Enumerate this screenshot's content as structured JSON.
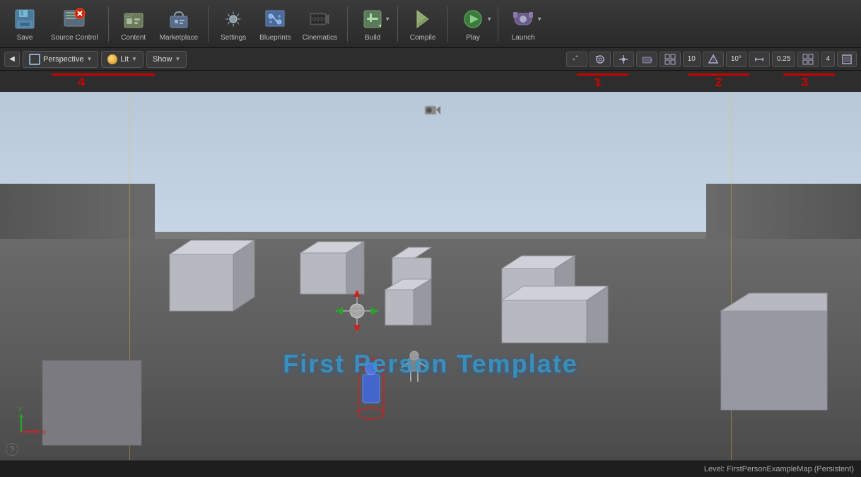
{
  "toolbar": {
    "buttons": [
      {
        "id": "save",
        "label": "Save",
        "icon": "💾"
      },
      {
        "id": "source-control",
        "label": "Source Control",
        "icon": "📁",
        "badge": "!"
      },
      {
        "id": "content",
        "label": "Content",
        "icon": "📂"
      },
      {
        "id": "marketplace",
        "label": "Marketplace",
        "icon": "🛒"
      },
      {
        "id": "settings",
        "label": "Settings",
        "icon": "⚙️"
      },
      {
        "id": "blueprints",
        "label": "Blueprints",
        "icon": "📋"
      },
      {
        "id": "cinematics",
        "label": "Cinematics",
        "icon": "🎬"
      },
      {
        "id": "build",
        "label": "Build",
        "icon": "🔨"
      },
      {
        "id": "compile",
        "label": "Compile",
        "icon": "⚡"
      },
      {
        "id": "play",
        "label": "Play",
        "icon": "▶"
      },
      {
        "id": "launch",
        "label": "Launch",
        "icon": "🚀"
      }
    ]
  },
  "viewport_bar": {
    "left_controls": [
      {
        "id": "toggle",
        "label": "◀"
      },
      {
        "id": "perspective",
        "label": "Perspective",
        "has_icon": true
      },
      {
        "id": "lit",
        "label": "Lit",
        "has_icon": true
      },
      {
        "id": "show",
        "label": "Show"
      }
    ],
    "right_controls": [
      {
        "id": "transform-mode",
        "icon": "⊕",
        "tooltip": "Transform"
      },
      {
        "id": "rotate-mode",
        "icon": "↻",
        "tooltip": "Rotate"
      },
      {
        "id": "scale-mode",
        "icon": "↔",
        "tooltip": "Scale"
      },
      {
        "id": "camera-speed",
        "icon": "📷",
        "tooltip": "Camera Speed"
      },
      {
        "id": "grid-snap",
        "icon": "⊞",
        "tooltip": "Grid Snap"
      },
      {
        "id": "grid-size",
        "label": "10",
        "tooltip": "Grid Size"
      },
      {
        "id": "angle-snap",
        "icon": "△",
        "tooltip": "Angle Snap"
      },
      {
        "id": "angle-size",
        "label": "10°",
        "tooltip": "Angle Size"
      },
      {
        "id": "scale-snap",
        "icon": "↕",
        "tooltip": "Scale Snap"
      },
      {
        "id": "scale-size",
        "label": "0.25",
        "tooltip": "Scale Size"
      },
      {
        "id": "viewport-size",
        "icon": "⊡",
        "tooltip": "Viewport Size"
      },
      {
        "id": "viewport-num",
        "label": "4",
        "tooltip": "Viewport Num"
      },
      {
        "id": "maximize",
        "icon": "⊡",
        "tooltip": "Maximize"
      }
    ]
  },
  "red_bars": [
    {
      "id": "bar1",
      "left_pct": 67,
      "width_pct": 6,
      "number": "1",
      "number_left_pct": 68
    },
    {
      "id": "bar2",
      "left_pct": 80,
      "width_pct": 7,
      "number": "2",
      "number_left_pct": 83
    },
    {
      "id": "bar3",
      "left_pct": 91,
      "width_pct": 6,
      "number": "3",
      "number_left_pct": 94
    },
    {
      "id": "bar4",
      "left_pct": 6,
      "width_pct": 12,
      "number": "4",
      "number_left_pct": 9
    }
  ],
  "scene": {
    "fps_text": "First Person Template",
    "level_name": "Level:  FirstPersonExampleMap (Persistent)"
  },
  "status_bar": {
    "help_icon": "?",
    "level_info": "Level:  FirstPersonExampleMap (Persistent)"
  }
}
